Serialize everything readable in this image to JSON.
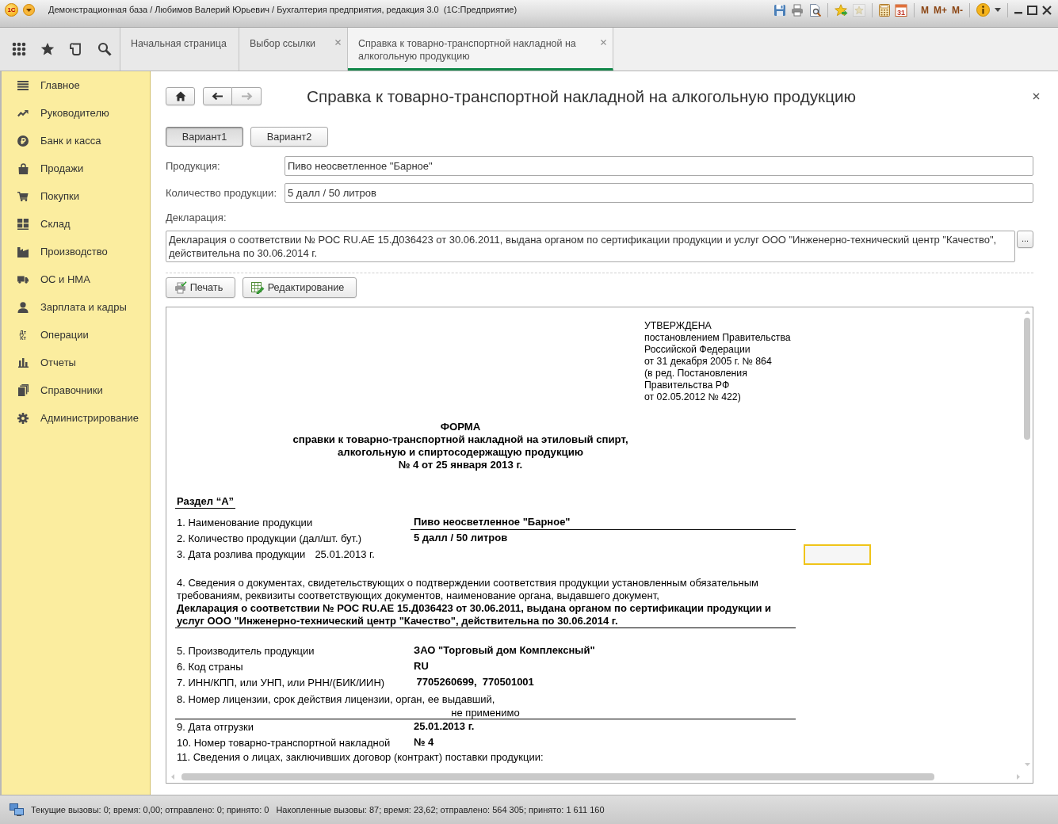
{
  "window": {
    "logo_text": "1С",
    "title": "Демонстрационная база / Любимов Валерий Юрьевич / Бухгалтерия предприятия, редакция 3.0  (1С:Предприятие)",
    "toolbar": [
      {
        "kind": "save",
        "disabled": false
      },
      {
        "kind": "print",
        "disabled": false
      },
      {
        "kind": "preview",
        "disabled": false
      },
      {
        "kind": "add-favorite",
        "disabled": false
      },
      {
        "kind": "favorite",
        "disabled": true
      },
      {
        "kind": "calculator",
        "disabled": false
      },
      {
        "kind": "calendar",
        "text": "31",
        "disabled": false
      },
      {
        "kind": "memory",
        "text": "M",
        "disabled": false
      },
      {
        "kind": "memory",
        "text": "M+",
        "disabled": false
      },
      {
        "kind": "memory",
        "text": "M-",
        "disabled": false
      },
      {
        "kind": "info",
        "disabled": false
      }
    ]
  },
  "tabs": [
    {
      "label": "Начальная страница",
      "closable": false,
      "selected": false
    },
    {
      "label": "Выбор ссылки",
      "closable": true,
      "selected": false
    },
    {
      "label": "Справка к товарно-транспортной накладной на алкогольную продукцию",
      "closable": true,
      "selected": true
    }
  ],
  "sidebar": {
    "items": [
      {
        "label": "Главное"
      },
      {
        "label": "Руководителю"
      },
      {
        "label": "Банк и касса"
      },
      {
        "label": "Продажи"
      },
      {
        "label": "Покупки"
      },
      {
        "label": "Склад"
      },
      {
        "label": "Производство"
      },
      {
        "label": "ОС и НМА"
      },
      {
        "label": "Зарплата и кадры"
      },
      {
        "label": "Операции",
        "icon_text": [
          "Дт",
          "Кт"
        ]
      },
      {
        "label": "Отчеты"
      },
      {
        "label": "Справочники"
      },
      {
        "label": "Администрирование"
      }
    ]
  },
  "form": {
    "title": "Справка к товарно-транспортной накладной на алкогольную продукцию",
    "nav": [
      {
        "kind": "back",
        "disabled": false
      },
      {
        "kind": "forward",
        "disabled": true
      }
    ],
    "variants": [
      {
        "label": "Вариант1",
        "selected": true
      },
      {
        "label": "Вариант2",
        "selected": false
      }
    ],
    "fields": [
      {
        "label": "Продукция:",
        "value": "Пиво неосветленное \"Барное\""
      },
      {
        "label": "Количество продукции:",
        "value": "5 далл / 50 литров"
      }
    ],
    "declaration": {
      "label": "Декларация:",
      "value": "Декларация о соответствии № РОС RU.АЕ 15.Д036423 от 30.06.2011, выдана органом по сертификации продукции и услуг ООО \"Инженерно-технический центр \"Качество\", действительна по 30.06.2014 г.",
      "button": "..."
    },
    "actions": [
      {
        "kind": "print",
        "label": "Печать"
      },
      {
        "kind": "edit",
        "label": "Редактирование"
      }
    ]
  },
  "document": {
    "approval": [
      "УТВЕРЖДЕНА",
      "постановлением Правительства",
      "Российской Федерации",
      "от 31 декабря 2005 г. № 864",
      "(в ред. Постановления",
      "Правительства РФ",
      "от 02.05.2012 № 422)"
    ],
    "heading": [
      "ФОРМА",
      "справки к товарно-транспортной накладной на этиловый спирт,",
      "алкогольную и спиртосодержащую продукцию",
      "№ 4 от 25 января 2013 г."
    ],
    "section": "Раздел “А”",
    "rows": [
      {
        "kind": "pair",
        "label": "1. Наименование продукции",
        "value": "Пиво неосветленное \"Барное\"",
        "underline": true,
        "selected": false
      },
      {
        "kind": "pair",
        "label": "2. Количество продукции (дал/шт. бут.)",
        "value": "5 далл / 50 литров",
        "underline": false,
        "selected": false
      },
      {
        "kind": "inline",
        "label": "3. Дата розлива продукции",
        "value": "25.01.2013 г.",
        "underline": false,
        "selected": true
      },
      {
        "kind": "paragraph",
        "label": "4. Сведения о документах, свидетельствующих о подтверждении соответствия продукции установленным обязательным требованиям, реквизиты соответствующих документов, наименование органа, выдавшего документ,",
        "value": "Декларация о соответствии № РОС RU.АЕ 15.Д036423 от 30.06.2011, выдана органом по сертификации продукции и услуг ООО \"Инженерно-технический центр \"Качество\", действительна по 30.06.2014 г.",
        "underline": true,
        "selected": false
      },
      {
        "kind": "pair",
        "label": "5. Производитель продукции",
        "value": "ЗАО \"Торговый дом Комплексный\"",
        "underline": false,
        "selected": false
      },
      {
        "kind": "pair",
        "label": "6. Код страны",
        "value": "RU",
        "underline": false,
        "selected": false
      },
      {
        "kind": "pair",
        "label": "7. ИНН/КПП, или УНП, или РНН/(БИК/ИИН)",
        "value": " 7705260699,  770501001",
        "underline": false,
        "selected": false
      },
      {
        "kind": "note",
        "label": "8. Номер лицензии, срок действия лицензии, орган, ее выдавший,",
        "value": "не применимо",
        "underline": true,
        "selected": false
      },
      {
        "kind": "pair",
        "label": "9. Дата отгрузки",
        "value": "25.01.2013 г.",
        "underline": false,
        "selected": false
      },
      {
        "kind": "pair",
        "label": "10. Номер товарно-транспортной накладной",
        "value": "№ 4",
        "underline": false,
        "selected": false
      },
      {
        "kind": "line",
        "label": "11. Сведения о лицах, заключивших договор (контракт) поставки продукции:",
        "underline": false,
        "selected": false
      }
    ]
  },
  "status_bar": {
    "items": [
      "Текущие вызовы: 0; время: 0,00; отправлено: 0; принято: 0",
      "Накопленные вызовы: 87; время: 23,62; отправлено: 564 305; принято: 1 611 160"
    ]
  }
}
